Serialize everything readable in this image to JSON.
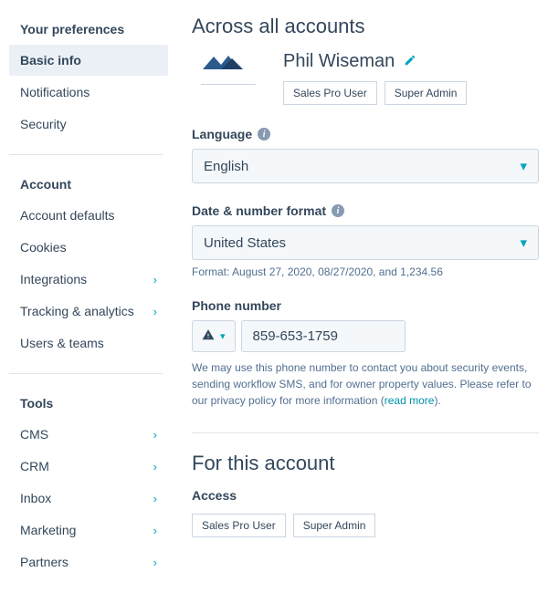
{
  "sidebar": {
    "groups": [
      {
        "title": "Your preferences",
        "items": [
          {
            "label": "Basic info",
            "active": true,
            "chev": false
          },
          {
            "label": "Notifications",
            "active": false,
            "chev": false
          },
          {
            "label": "Security",
            "active": false,
            "chev": false
          }
        ]
      },
      {
        "title": "Account",
        "items": [
          {
            "label": "Account defaults",
            "chev": false
          },
          {
            "label": "Cookies",
            "chev": false
          },
          {
            "label": "Integrations",
            "chev": true
          },
          {
            "label": "Tracking & analytics",
            "chev": true
          },
          {
            "label": "Users & teams",
            "chev": false
          }
        ]
      },
      {
        "title": "Tools",
        "items": [
          {
            "label": "CMS",
            "chev": true
          },
          {
            "label": "CRM",
            "chev": true
          },
          {
            "label": "Inbox",
            "chev": true
          },
          {
            "label": "Marketing",
            "chev": true
          },
          {
            "label": "Partners",
            "chev": true
          }
        ]
      }
    ]
  },
  "main": {
    "heading_all": "Across all accounts",
    "user_name": "Phil Wiseman",
    "badges": [
      "Sales Pro User",
      "Super Admin"
    ],
    "language": {
      "label": "Language",
      "value": "English"
    },
    "date_format": {
      "label": "Date & number format",
      "value": "United States",
      "hint": "Format: August 27, 2020, 08/27/2020, and 1,234.56"
    },
    "phone": {
      "label": "Phone number",
      "value": "859-653-1759",
      "help_pre": "We may use this phone number to contact you about security events, sending workflow SMS, and for owner property values. Please refer to our privacy policy for more information (",
      "help_link": "read more",
      "help_post": ")."
    },
    "heading_account": "For this account",
    "access_label": "Access",
    "access_badges": [
      "Sales Pro User",
      "Super Admin"
    ]
  }
}
